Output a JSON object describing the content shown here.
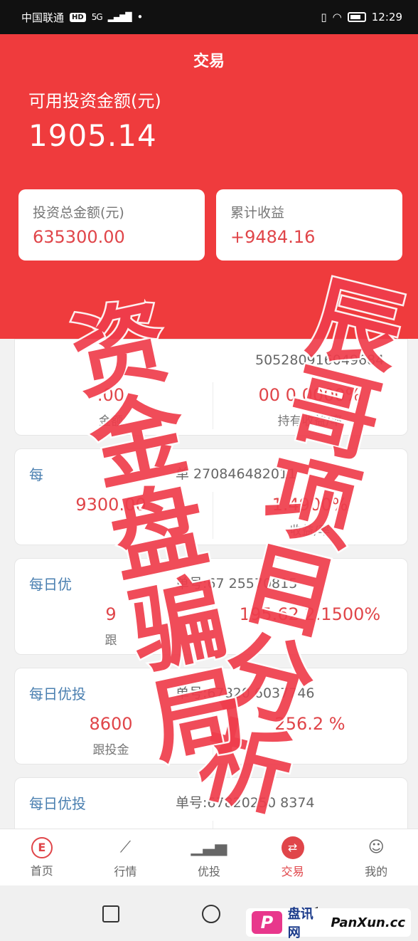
{
  "status_bar": {
    "carrier": "中国联通",
    "hd": "HD",
    "network": "5G",
    "dot": "•",
    "time": "12:29"
  },
  "header": {
    "title": "交易",
    "available_label": "可用投资金额(元)",
    "available_value": "1905.14",
    "total_label": "投资总金额(元)",
    "total_value": "635300.00",
    "earnings_label": "累计收益",
    "earnings_value": "+9484.16"
  },
  "orders": [
    {
      "tag": "",
      "order_no": "50528091604968​4",
      "amount": ".00",
      "amount_label": "金额",
      "yield": "00  0.0000%",
      "yield_label": "持有收益/率"
    },
    {
      "tag": "每",
      "order_no": "单                270846482011",
      "amount": "9300.00",
      "amount_label": "",
      "yield": "1.4900%",
      "yield_label": "收益/率"
    },
    {
      "tag": "每日优",
      "order_no": "单号:67            25570815",
      "amount": "9",
      "amount_label": "跟",
      "yield": "195.62  2.1500%",
      "yield_label": ""
    },
    {
      "tag": "每日优投",
      "order_no": "单号:67820            6037746",
      "amount": "8600",
      "amount_label": "跟投金",
      "yield": "256.2         %",
      "yield_label": ""
    },
    {
      "tag": "每日优投",
      "order_no": "单号:67820250            8374",
      "amount": "",
      "amount_label": "",
      "yield": "",
      "yield_label": ""
    }
  ],
  "tabbar": {
    "items": [
      {
        "label": "首页",
        "icon": "home-logo-icon"
      },
      {
        "label": "行情",
        "icon": "chart-icon"
      },
      {
        "label": "优投",
        "icon": "bar-chart-icon"
      },
      {
        "label": "交易",
        "icon": "exchange-icon"
      },
      {
        "label": "我的",
        "icon": "user-icon"
      }
    ]
  },
  "watermark": {
    "line1": "辰哥项目分析",
    "line2": "资金盘骗局"
  },
  "site_badge": {
    "cn": "盘讯网",
    "en": "PanXun.cc"
  },
  "colors": {
    "accent": "#ef3b3d",
    "value_red": "#e04549",
    "tag_blue": "#4a7fb0"
  }
}
